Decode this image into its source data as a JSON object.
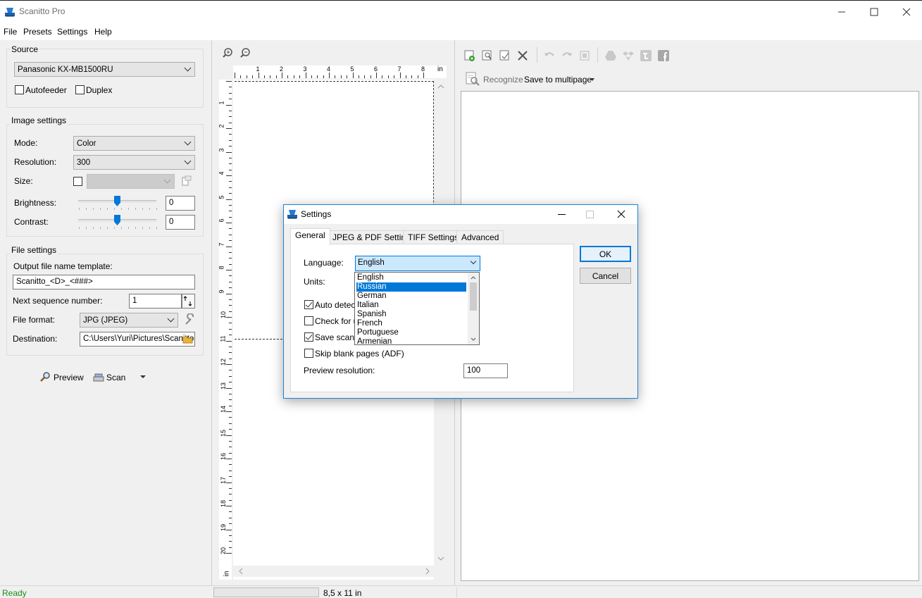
{
  "app": {
    "title": "Scanitto Pro",
    "icon": "scanner-icon"
  },
  "menu": [
    "File",
    "Presets",
    "Settings",
    "Help"
  ],
  "source": {
    "title": "Source",
    "device": "Panasonic KX-MB1500RU",
    "autofeeder_label": "Autofeeder",
    "autofeeder_checked": false,
    "duplex_label": "Duplex",
    "duplex_checked": false
  },
  "image_settings": {
    "title": "Image settings",
    "mode_label": "Mode:",
    "mode_value": "Color",
    "resolution_label": "Resolution:",
    "resolution_value": "300",
    "size_label": "Size:",
    "size_checked": false,
    "brightness_label": "Brightness:",
    "brightness_value": "0",
    "brightness_fraction": 0.5,
    "contrast_label": "Contrast:",
    "contrast_value": "0",
    "contrast_fraction": 0.5
  },
  "file_settings": {
    "title": "File settings",
    "template_label": "Output file name template:",
    "template_value": "Scanitto_<D>_<###>",
    "sequence_label": "Next sequence number:",
    "sequence_value": "1",
    "format_label": "File format:",
    "format_value": "JPG (JPEG)",
    "destination_label": "Destination:",
    "destination_value": "C:\\Users\\Yuri\\Pictures\\Scanitto"
  },
  "actions": {
    "preview_label": "Preview",
    "scan_label": "Scan"
  },
  "ruler": {
    "unit": "in",
    "h_ticks": [
      "1",
      "2",
      "3",
      "4",
      "5",
      "6",
      "7",
      "8"
    ],
    "v_ticks": [
      "1",
      "2",
      "3",
      "4",
      "5",
      "6",
      "7",
      "8",
      "9",
      "10",
      "11",
      "12",
      "13",
      "14",
      "15",
      "16",
      "17",
      "18",
      "19",
      "20"
    ]
  },
  "right_toolbar": {
    "recognize_label": "Recognize",
    "save_multipage_label": "Save to multipage"
  },
  "status": {
    "ready": "Ready",
    "page_size": "8,5 x 11 in",
    "ready_color": "#1a8a1a"
  },
  "dialog": {
    "title": "Settings",
    "tabs": [
      "General",
      "JPEG & PDF Settings",
      "TIFF Settings",
      "Advanced"
    ],
    "active_tab": "General",
    "language_label": "Language:",
    "language_value": "English",
    "language_options": [
      "English",
      "Russian",
      "German",
      "Italian",
      "Spanish",
      "French",
      "Portuguese",
      "Armenian"
    ],
    "language_highlighted": "Russian",
    "units_label": "Units:",
    "auto_detect_label": "Auto detect",
    "auto_detect_checked": true,
    "check_updates_label": "Check for up",
    "check_updates_checked": false,
    "save_scanned_label": "Save scann",
    "save_scanned_checked": true,
    "skip_blank_label": "Skip blank pages (ADF)",
    "skip_blank_checked": false,
    "preview_res_label": "Preview resolution:",
    "preview_res_value": "100",
    "ok_label": "OK",
    "cancel_label": "Cancel"
  },
  "colors": {
    "accent": "#0078d7",
    "selection": "#0078d7"
  }
}
